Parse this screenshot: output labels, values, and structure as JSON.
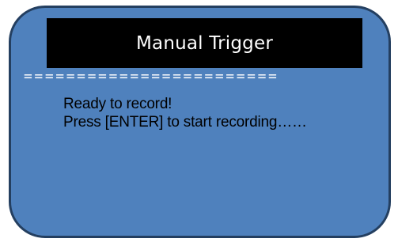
{
  "screen": {
    "title": "Manual Trigger",
    "divider": "========================",
    "lines": [
      "Ready to record!",
      "Press [ENTER] to start recording……"
    ]
  },
  "colors": {
    "screen_background": "#4f81bd",
    "screen_border": "#243f60",
    "title_background": "#000000",
    "title_text": "#ffffff",
    "divider_text": "#ffffff",
    "message_text": "#000000"
  }
}
